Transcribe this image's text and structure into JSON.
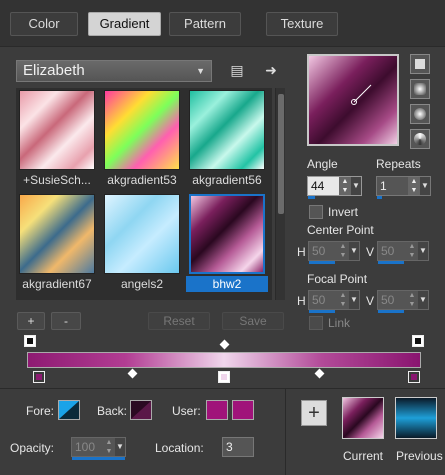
{
  "tabs": [
    {
      "label": "Color"
    },
    {
      "label": "Gradient"
    },
    {
      "label": "Pattern"
    },
    {
      "label": "Texture"
    }
  ],
  "active_tab": "Gradient",
  "gradient_dropdown": {
    "value": "Elizabeth"
  },
  "gradients": [
    {
      "name": "+SusieSch..."
    },
    {
      "name": "akgradient53"
    },
    {
      "name": "akgradient56"
    },
    {
      "name": "akgradient67"
    },
    {
      "name": "angels2"
    },
    {
      "name": "bhw2"
    }
  ],
  "selected_gradient": "bhw2",
  "buttons": {
    "add": "+",
    "remove": "-",
    "reset": "Reset",
    "save": "Save"
  },
  "angle": {
    "label": "Angle",
    "value": "44"
  },
  "repeats": {
    "label": "Repeats",
    "value": "1"
  },
  "invert": {
    "label": "Invert",
    "checked": false
  },
  "center_point": {
    "label": "Center Point",
    "h_label": "H",
    "h_value": "50",
    "v_label": "V",
    "v_value": "50"
  },
  "focal_point": {
    "label": "Focal Point",
    "h_label": "H",
    "h_value": "50",
    "v_label": "V",
    "v_value": "50"
  },
  "link": {
    "label": "Link"
  },
  "fore": {
    "label": "Fore:",
    "color": "#1aa3e8"
  },
  "back": {
    "label": "Back:",
    "color": "#2a0a22"
  },
  "user": {
    "label": "User:",
    "color1": "#a0137a",
    "color2": "#a0137a"
  },
  "opacity": {
    "label": "Opacity:",
    "value": "100"
  },
  "location": {
    "label": "Location:",
    "value": "3"
  },
  "current": {
    "label": "Current"
  },
  "previous": {
    "label": "Previous"
  }
}
